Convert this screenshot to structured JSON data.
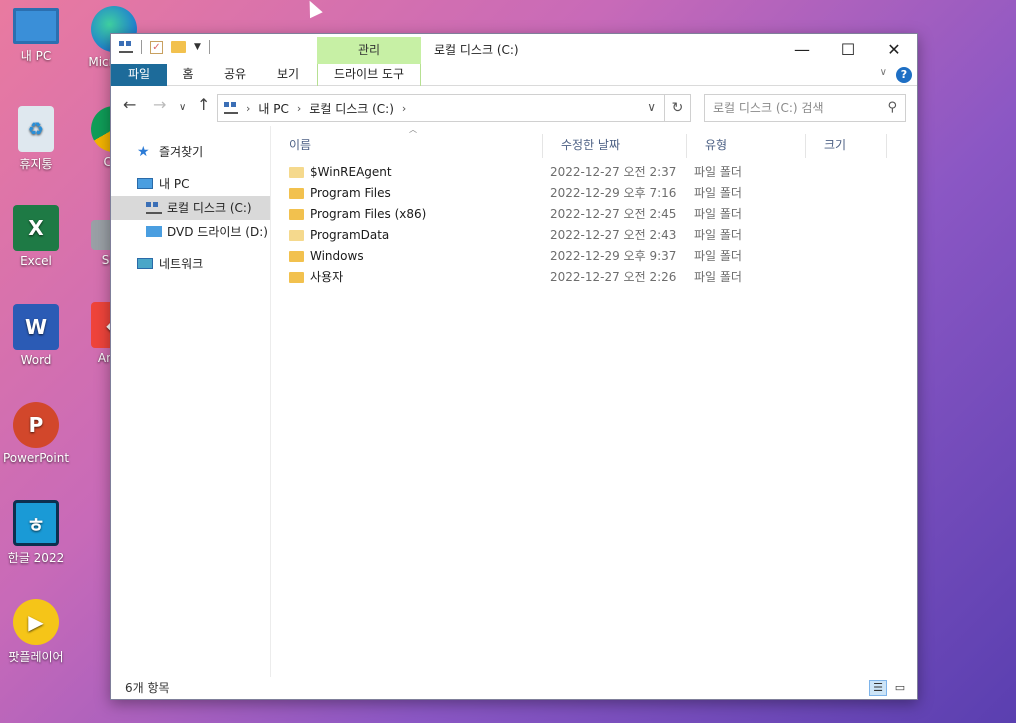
{
  "desktop": {
    "icons": [
      {
        "label": "내 PC",
        "icon": "monitor-icon",
        "color": "#3a8fd8"
      },
      {
        "label": "Micro Ed",
        "icon": "edge-icon",
        "color": "#1f7fd0"
      },
      {
        "label": "휴지통",
        "icon": "recycle-bin-icon",
        "color": "#c9d6e0"
      },
      {
        "label": "Chr",
        "icon": "chrome-icon",
        "color": "#db4437"
      },
      {
        "label": "Excel",
        "icon": "excel-icon",
        "color": "#1e7a45"
      },
      {
        "label": "SSD",
        "icon": "ssd-icon",
        "color": "#9aa0a6"
      },
      {
        "label": "Word",
        "icon": "word-icon",
        "color": "#2b5bb5"
      },
      {
        "label": "AnyD",
        "icon": "anydesk-icon",
        "color": "#ef443b"
      },
      {
        "label": "PowerPoint",
        "icon": "powerpoint-icon",
        "color": "#d2472b"
      },
      {
        "label": "한글 2022",
        "icon": "hangul-icon",
        "color": "#1a9ad6"
      },
      {
        "label": "팟플레이어",
        "icon": "potplayer-icon",
        "color": "#f5c518"
      }
    ]
  },
  "window": {
    "title": "로컬 디스크 (C:)",
    "context_tab_header": "관리",
    "ribbon_tabs": [
      "파일",
      "홈",
      "공유",
      "보기"
    ],
    "context_tab": "드라이브 도구",
    "help": "?"
  },
  "nav": {
    "breadcrumb": [
      "내 PC",
      "로컬 디스크 (C:)"
    ],
    "search_placeholder": "로컬 디스크 (C:) 검색"
  },
  "sidebar": {
    "items": [
      {
        "label": "즐겨찾기",
        "icon": "star-icon"
      },
      {
        "label": "내 PC",
        "icon": "pc-icon"
      },
      {
        "label": "로컬 디스크 (C:)",
        "icon": "drive-icon",
        "selected": true
      },
      {
        "label": "DVD 드라이브 (D:)",
        "icon": "dvd-icon"
      },
      {
        "label": "네트워크",
        "icon": "network-icon"
      }
    ]
  },
  "columns": [
    "이름",
    "수정한 날짜",
    "유형",
    "크기"
  ],
  "files": [
    {
      "name": "$WinREAgent",
      "date": "2022-12-27 오전 2:37",
      "type": "파일 폴더",
      "hidden": true
    },
    {
      "name": "Program Files",
      "date": "2022-12-29 오후 7:16",
      "type": "파일 폴더"
    },
    {
      "name": "Program Files (x86)",
      "date": "2022-12-27 오전 2:45",
      "type": "파일 폴더"
    },
    {
      "name": "ProgramData",
      "date": "2022-12-27 오전 2:43",
      "type": "파일 폴더",
      "hidden": true
    },
    {
      "name": "Windows",
      "date": "2022-12-29 오후 9:37",
      "type": "파일 폴더"
    },
    {
      "name": "사용자",
      "date": "2022-12-27 오전 2:26",
      "type": "파일 폴더"
    }
  ],
  "status": {
    "item_count": "6개 항목"
  }
}
